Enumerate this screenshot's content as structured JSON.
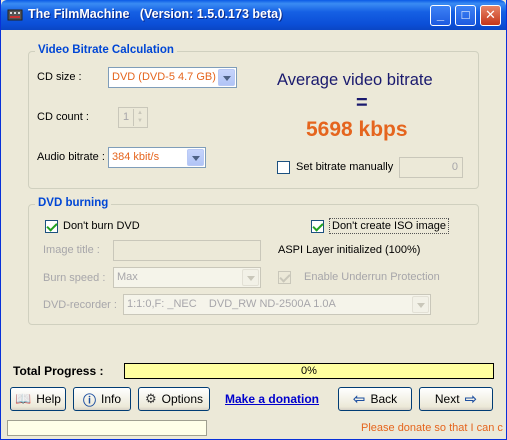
{
  "window": {
    "title": "The FilmMachine   (Version: 1.5.0.173 beta)",
    "minimize_label": "_",
    "maximize_label": "□",
    "close_label": "✕"
  },
  "bitrate_group": {
    "title": "Video Bitrate Calculation",
    "cd_size_label": "CD size :",
    "cd_size_value": "DVD (DVD-5 4.7 GB)",
    "cd_count_label": "CD count :",
    "cd_count_value": "1",
    "audio_bitrate_label": "Audio bitrate :",
    "audio_bitrate_value": "384 kbit/s",
    "avg_heading": "Average video bitrate",
    "equals": "=",
    "bitrate_value": "5698 kbps",
    "set_manually_label": "Set bitrate manually",
    "set_manually_checked": false,
    "manual_value": "0"
  },
  "dvd_group": {
    "title": "DVD burning",
    "dont_burn_label": "Don't burn DVD",
    "dont_burn_checked": true,
    "dont_create_iso_label": "Don't create ISO image",
    "dont_create_iso_checked": true,
    "image_title_label": "Image title :",
    "image_title_value": "",
    "aspi_status": "ASPI Layer initialized (100%)",
    "burn_speed_label": "Burn speed :",
    "burn_speed_value": "Max",
    "underrun_label": "Enable Underrun Protection",
    "underrun_checked": true,
    "recorder_label": "DVD-recorder :",
    "recorder_value": "1:1:0,F: _NEC    DVD_RW ND-2500A 1.0A"
  },
  "progress": {
    "label": "Total Progress :",
    "percent_text": "0%",
    "fraction": 0
  },
  "buttons": {
    "help": "Help",
    "info": "Info",
    "options": "Options",
    "donation_link": "Make a donation",
    "back": "Back",
    "next": "Next"
  },
  "status_bar": {
    "message": "Please donate so that I can co"
  },
  "colors": {
    "accent_blue": "#0046d5",
    "bitrate_orange": "#e5651e",
    "heading_navy": "#1a1a6e",
    "progress_fill": "#ffffa0"
  }
}
